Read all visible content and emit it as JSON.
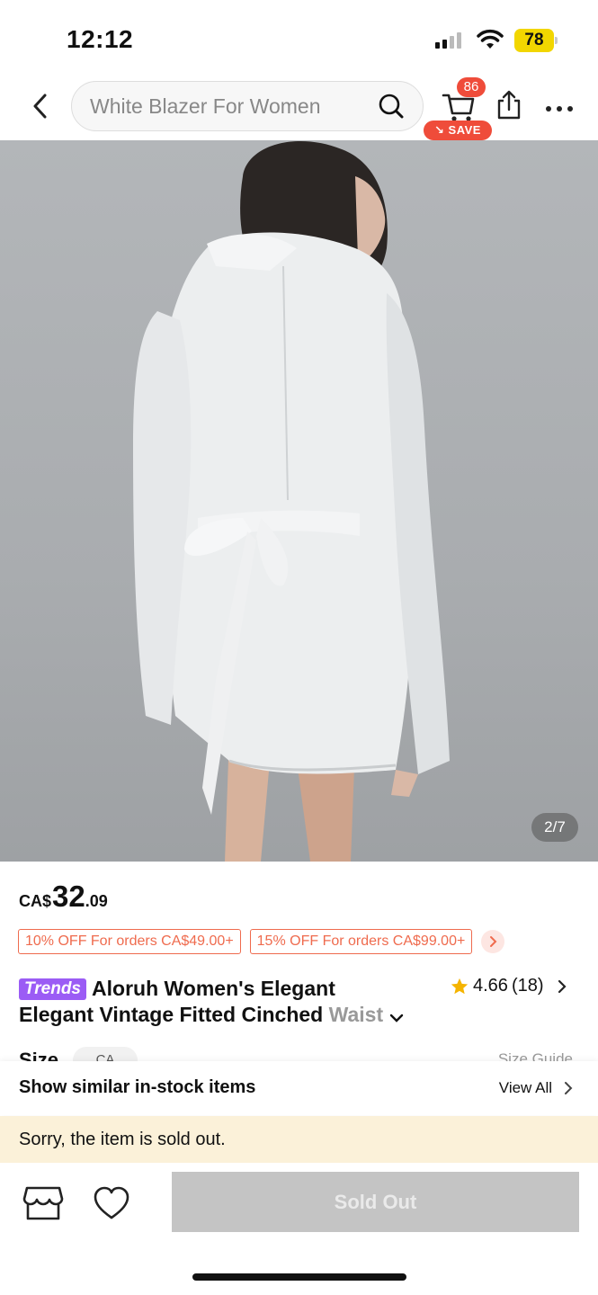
{
  "status_bar": {
    "time": "12:12",
    "battery": "78"
  },
  "header": {
    "search_placeholder": "White Blazer For Women",
    "cart_count": "86",
    "save_label": "SAVE"
  },
  "gallery": {
    "page_indicator": "2/7"
  },
  "product": {
    "currency": "CA$",
    "price_int": "32",
    "price_dec": ".09",
    "coupons": [
      "10% OFF For orders CA$49.00+",
      "15% OFF For orders CA$99.00+"
    ],
    "tag": "Trends",
    "title_line1": "Aloruh Women's Elegant",
    "title_line2": "Elegant Vintage Fitted Cinched ",
    "title_fade": "Waist",
    "rating": "4.66",
    "review_count": "(18)"
  },
  "size": {
    "label": "Size",
    "selected": "CA",
    "guide": "Size Guide"
  },
  "similar": {
    "label": "Show similar in-stock items",
    "view_all": "View All"
  },
  "notice": {
    "sold_out_message": "Sorry, the item is sold out."
  },
  "actions": {
    "sold_out_button": "Sold Out"
  },
  "colors": {
    "accent_red": "#ef4c3a",
    "coupon_orange": "#ef6b4e",
    "trends_purple": "#9b5cf5",
    "notice_bg": "#fbf1d9",
    "star": "#f5b400",
    "disabled_button": "#c4c4c4"
  }
}
